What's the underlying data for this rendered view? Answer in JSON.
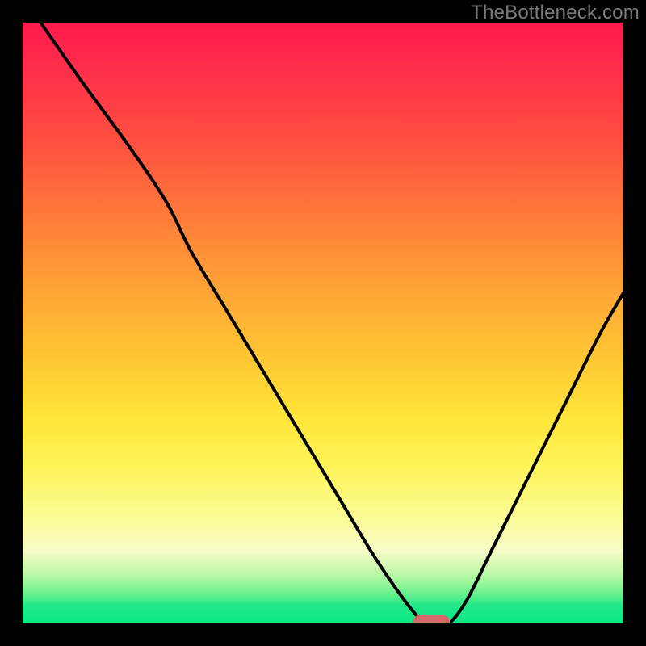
{
  "watermark": {
    "text": "TheBottleneck.com"
  },
  "chart_data": {
    "type": "line",
    "title": "",
    "xlabel": "",
    "ylabel": "",
    "xlim": [
      0,
      100
    ],
    "ylim": [
      0,
      100
    ],
    "grid": false,
    "legend": false,
    "series": [
      {
        "name": "bottleneck-curve",
        "x": [
          3,
          10,
          18,
          24,
          28,
          34,
          40,
          46,
          52,
          58,
          62,
          65,
          67,
          69,
          71,
          74,
          78,
          84,
          90,
          96,
          100
        ],
        "y": [
          100,
          90,
          79,
          70,
          62,
          52,
          42,
          32,
          22,
          12,
          6,
          2,
          0,
          0,
          0,
          4,
          12,
          24,
          36,
          48,
          55
        ]
      }
    ],
    "marker": {
      "x": 68,
      "y": 0,
      "color": "#d46a6a"
    },
    "background_gradient": {
      "stops": [
        {
          "pos": 0,
          "color": "#ff1a4d"
        },
        {
          "pos": 20,
          "color": "#ff5040"
        },
        {
          "pos": 44,
          "color": "#ffa336"
        },
        {
          "pos": 66,
          "color": "#ffe63a"
        },
        {
          "pos": 82,
          "color": "#fcfc93"
        },
        {
          "pos": 92,
          "color": "#b8f8a4"
        },
        {
          "pos": 100,
          "color": "#09e884"
        }
      ]
    }
  }
}
